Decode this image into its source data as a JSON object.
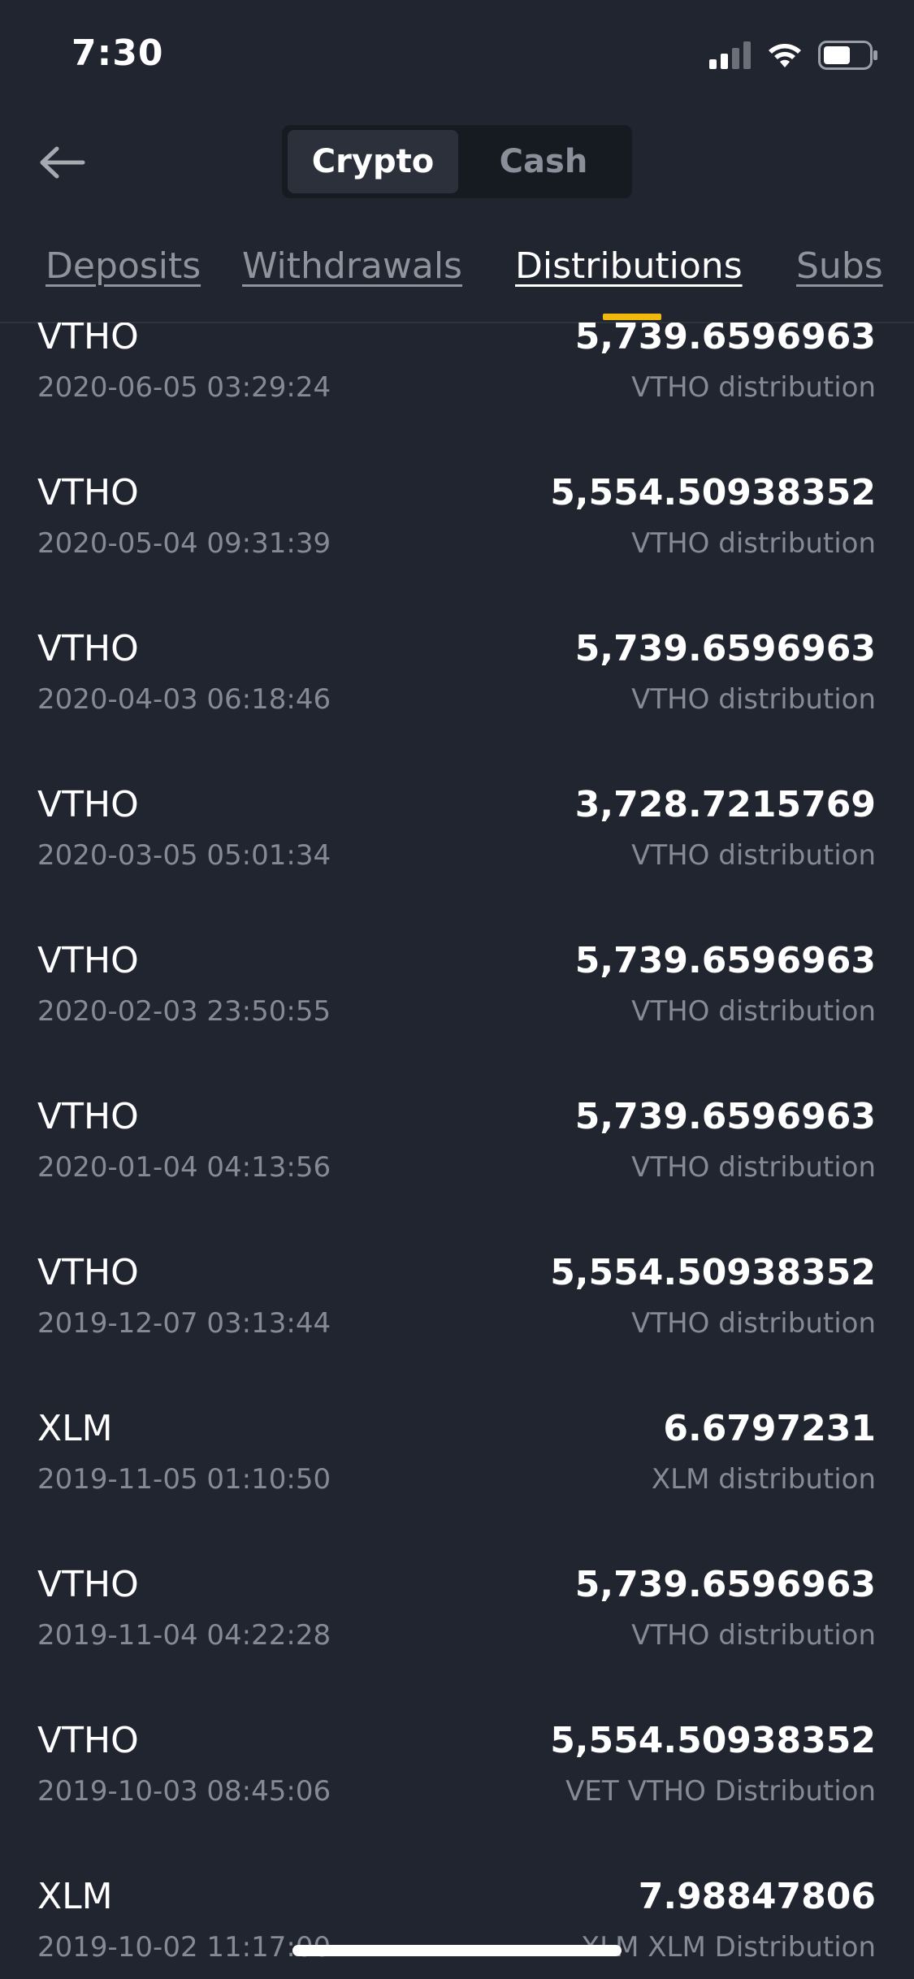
{
  "status_bar": {
    "time": "7:30"
  },
  "header": {
    "segments": [
      "Crypto",
      "Cash"
    ],
    "selected_segment": "Crypto"
  },
  "tabs": [
    {
      "label": "Deposits"
    },
    {
      "label": "Withdrawals"
    },
    {
      "label": "Distributions"
    },
    {
      "label": "Subs"
    }
  ],
  "active_tab": "Distributions",
  "colors": {
    "background": "#212530",
    "accent": "#f0b90b",
    "muted_text": "#858a94"
  },
  "transactions": [
    {
      "coin": "VTHO",
      "date": "2020-06-05 03:29:24",
      "amount": "5,739.6596963",
      "description": "VTHO distribution"
    },
    {
      "coin": "VTHO",
      "date": "2020-05-04 09:31:39",
      "amount": "5,554.50938352",
      "description": "VTHO distribution"
    },
    {
      "coin": "VTHO",
      "date": "2020-04-03 06:18:46",
      "amount": "5,739.6596963",
      "description": "VTHO distribution"
    },
    {
      "coin": "VTHO",
      "date": "2020-03-05 05:01:34",
      "amount": "3,728.7215769",
      "description": "VTHO distribution"
    },
    {
      "coin": "VTHO",
      "date": "2020-02-03 23:50:55",
      "amount": "5,739.6596963",
      "description": "VTHO distribution"
    },
    {
      "coin": "VTHO",
      "date": "2020-01-04 04:13:56",
      "amount": "5,739.6596963",
      "description": "VTHO distribution"
    },
    {
      "coin": "VTHO",
      "date": "2019-12-07 03:13:44",
      "amount": "5,554.50938352",
      "description": "VTHO distribution"
    },
    {
      "coin": "XLM",
      "date": "2019-11-05 01:10:50",
      "amount": "6.6797231",
      "description": "XLM distribution"
    },
    {
      "coin": "VTHO",
      "date": "2019-11-04 04:22:28",
      "amount": "5,739.6596963",
      "description": "VTHO distribution"
    },
    {
      "coin": "VTHO",
      "date": "2019-10-03 08:45:06",
      "amount": "5,554.50938352",
      "description": "VET VTHO Distribution"
    },
    {
      "coin": "XLM",
      "date": "2019-10-02 11:17:00",
      "amount": "7.98847806",
      "description": "XLM XLM Distribution"
    }
  ]
}
